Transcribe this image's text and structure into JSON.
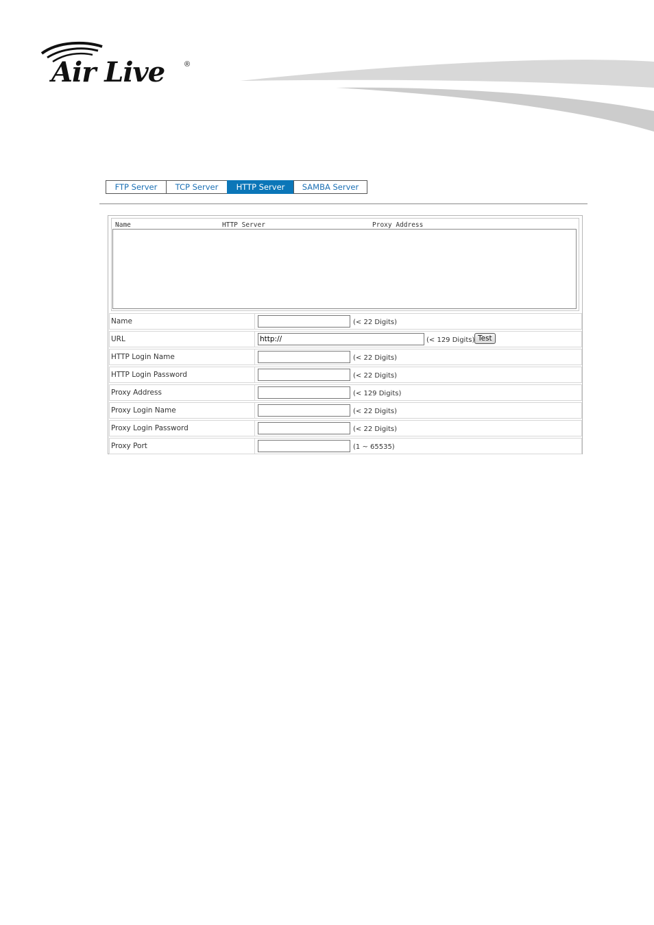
{
  "brand": {
    "logo_text": "Air Live",
    "registered_mark": "®"
  },
  "tabs": [
    {
      "label": "FTP Server",
      "active": false
    },
    {
      "label": "TCP Server",
      "active": false
    },
    {
      "label": "HTTP Server",
      "active": true
    },
    {
      "label": "SAMBA Server",
      "active": false
    }
  ],
  "server_list": {
    "columns": [
      "Name",
      "HTTP Server",
      "Proxy Address"
    ],
    "rows": []
  },
  "form": {
    "name": {
      "label": "Name",
      "value": "",
      "hint": "(< 22 Digits)"
    },
    "url": {
      "label": "URL",
      "value": "http://",
      "hint": "(< 129 Digits)",
      "test_label": "Test"
    },
    "http_login_name": {
      "label": "HTTP Login Name",
      "value": "",
      "hint": "(< 22 Digits)"
    },
    "http_login_password": {
      "label": "HTTP Login Password",
      "value": "",
      "hint": "(< 22 Digits)"
    },
    "proxy_address": {
      "label": "Proxy Address",
      "value": "",
      "hint": "(< 129 Digits)"
    },
    "proxy_login_name": {
      "label": "Proxy Login Name",
      "value": "",
      "hint": "(< 22 Digits)"
    },
    "proxy_login_password": {
      "label": "Proxy Login Password",
      "value": "",
      "hint": "(< 22 Digits)"
    },
    "proxy_port": {
      "label": "Proxy Port",
      "value": "",
      "hint": "(1 ~ 65535)"
    }
  },
  "colors": {
    "accent": "#0b76b8",
    "tab_text": "#1a6fb4"
  }
}
